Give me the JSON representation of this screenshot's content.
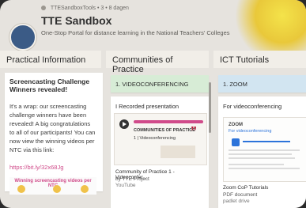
{
  "header": {
    "meta": "TTESandboxTools • 3 • 8 dagen",
    "title": "TTE Sandbox",
    "subtitle": "One-Stop Portal for distance learning in the National Teachers' Colleges"
  },
  "columns": [
    {
      "title": "Practical Information",
      "post": {
        "title": "Screencasting Challenge Winners revealed!",
        "body": "It's a wrap: our screencasting challenge winners have been revealed! A big congratulations to all of our participants! You can now view the winning videos per NTC via this link:",
        "link": "https://bit.ly/32x68Jg",
        "image_caption": "Winning screencasting videos per NTC"
      }
    },
    {
      "title": "Communities of Practice",
      "section": "1. VIDEOCONFERENCING",
      "card": {
        "title": "I Recorded presentation",
        "video_heading": "COMMUNITIES OF PRACTICE",
        "video_line": "1 | Videoconferencing",
        "footer_title": "Community of Practice 1 - Videoconfer...",
        "footer_by": "by TTE Project",
        "footer_source": "YouTube"
      }
    },
    {
      "title": "ICT Tutorials",
      "section": "1. ZOOM",
      "card": {
        "title": "For videoconferencing",
        "doc_heading": "ZOOM",
        "doc_subheading": "For videoconferencing",
        "footer_title": "Zoom CoP Tutorials",
        "footer_type": "PDF document",
        "footer_source": "padlet drive"
      }
    }
  ],
  "colors": {
    "accent_pink": "#d04b8a",
    "green_band": "#d7ecd6",
    "blue_band": "#d2e5f1"
  }
}
